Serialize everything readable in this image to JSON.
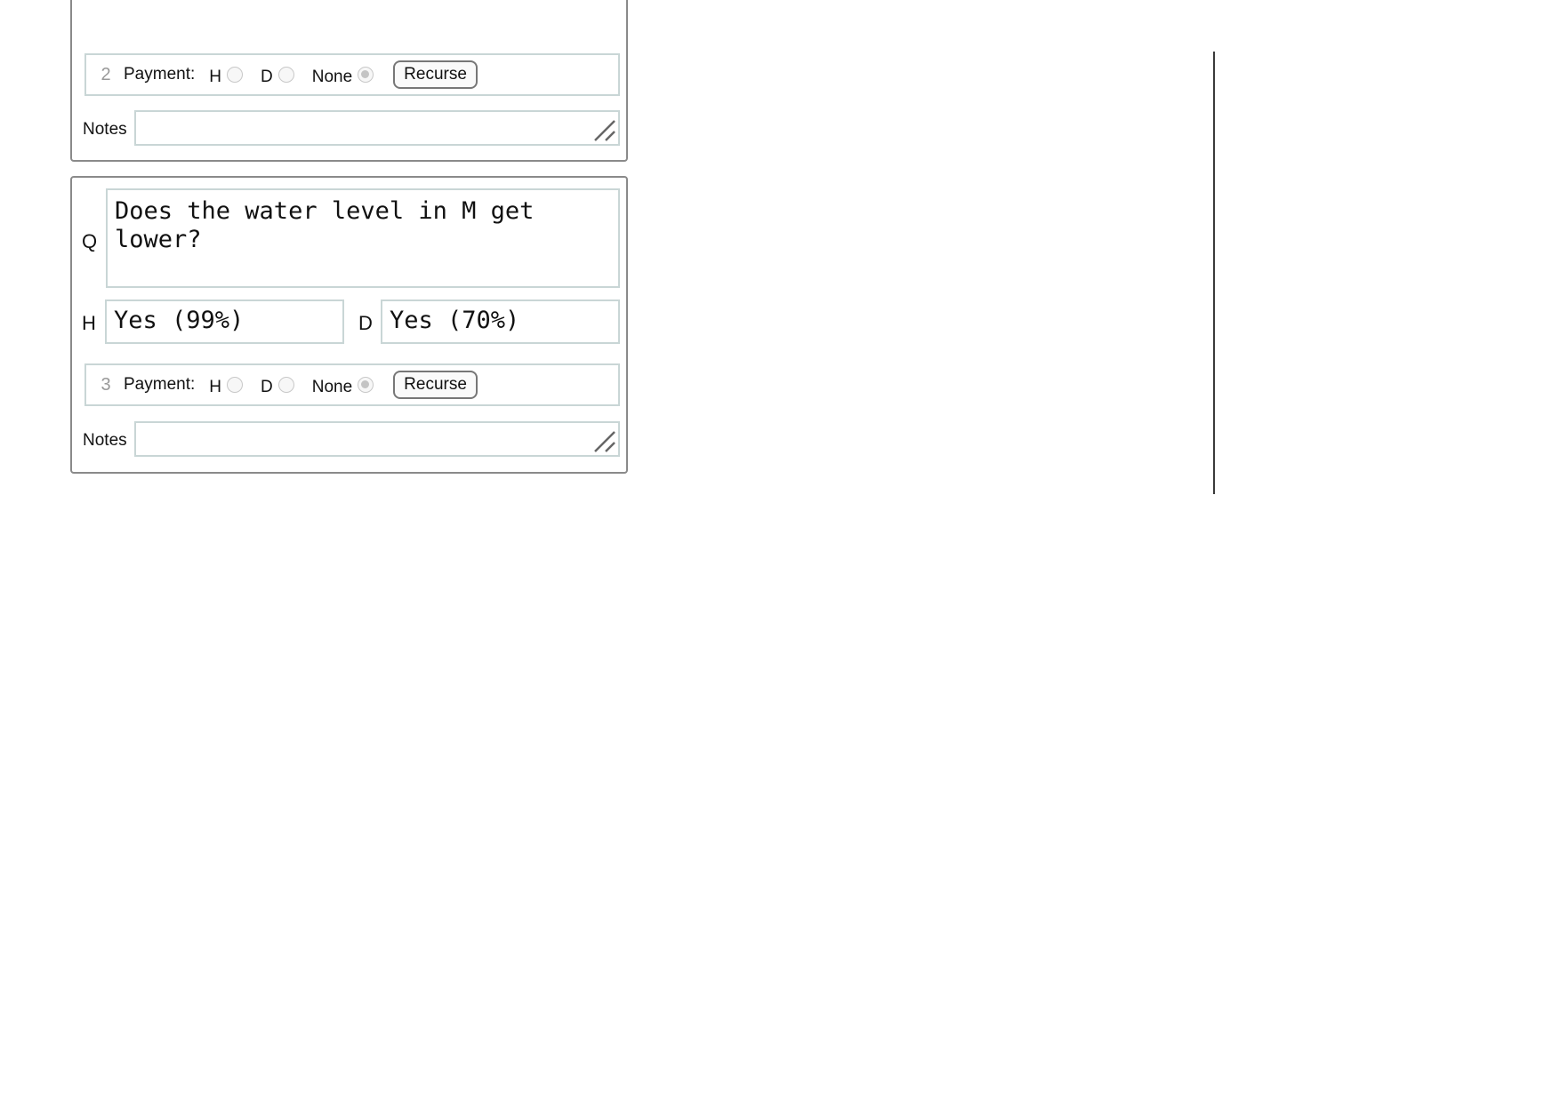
{
  "cards": [
    {
      "row_number": "2",
      "payment_label": "Payment:",
      "options": [
        "H",
        "D",
        "None"
      ],
      "selected_option": "None",
      "recurse_label": "Recurse",
      "notes_label": "Notes",
      "notes_value": ""
    },
    {
      "question_label": "Q",
      "question": "Does the water level in M get lower?",
      "h_label": "H",
      "h_answer": "Yes (99%)",
      "d_label": "D",
      "d_answer": "Yes (70%)",
      "row_number": "3",
      "payment_label": "Payment:",
      "options": [
        "H",
        "D",
        "None"
      ],
      "selected_option": "None",
      "recurse_label": "Recurse",
      "notes_label": "Notes",
      "notes_value": ""
    }
  ]
}
